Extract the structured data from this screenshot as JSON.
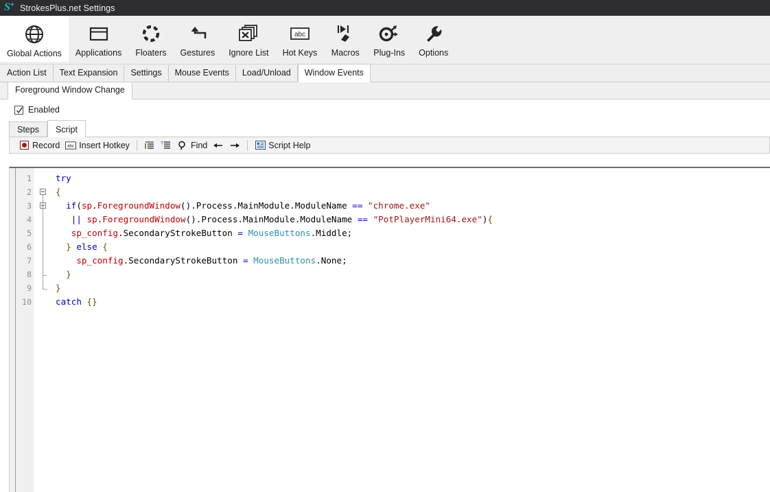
{
  "window": {
    "title": "StrokesPlus.net Settings",
    "icon": "strokesplus-logo-icon",
    "titlebar_bg": "#2d2d30",
    "titlebar_fg": "#f1f1f1"
  },
  "ribbon": {
    "items": [
      {
        "label": "Global Actions",
        "icon": "globe-icon",
        "selected": true
      },
      {
        "label": "Applications",
        "icon": "window-icon",
        "selected": false
      },
      {
        "label": "Floaters",
        "icon": "dashed-circle-icon",
        "selected": false
      },
      {
        "label": "Gestures",
        "icon": "gesture-arrow-icon",
        "selected": false
      },
      {
        "label": "Ignore List",
        "icon": "stacked-x-windows-icon",
        "selected": false
      },
      {
        "label": "Hot Keys",
        "icon": "abc-key-icon",
        "selected": false
      },
      {
        "label": "Macros",
        "icon": "macro-play-icon",
        "selected": false
      },
      {
        "label": "Plug-Ins",
        "icon": "plugin-node-icon",
        "selected": false
      },
      {
        "label": "Options",
        "icon": "wrench-icon",
        "selected": false
      }
    ]
  },
  "tabs": {
    "items": [
      {
        "label": "Action List",
        "active": false
      },
      {
        "label": "Text Expansion",
        "active": false
      },
      {
        "label": "Settings",
        "active": false
      },
      {
        "label": "Mouse Events",
        "active": false
      },
      {
        "label": "Load/Unload",
        "active": false
      },
      {
        "label": "Window Events",
        "active": true
      }
    ]
  },
  "subtabs": {
    "items": [
      {
        "label": "Foreground Window Change",
        "active": true
      }
    ]
  },
  "enabled": {
    "label": "Enabled",
    "checked": true
  },
  "script_tabs": {
    "items": [
      {
        "label": "Steps",
        "active": false
      },
      {
        "label": "Script",
        "active": true
      }
    ]
  },
  "script_toolbar": {
    "record_label": "Record",
    "record_icon": "record-circle-icon",
    "insert_hotkey_label": "Insert Hotkey",
    "insert_hotkey_icon": "abc-key-icon",
    "indent_icon": "indent-lines-icon",
    "uncomment_icon": "comment-lines-icon",
    "find_label": "Find",
    "find_icon": "magnifier-icon",
    "back_icon": "arrow-left-icon",
    "forward_icon": "arrow-right-icon",
    "script_help_label": "Script Help",
    "script_help_icon": "help-document-icon"
  },
  "editor": {
    "line_numbers": [
      "1",
      "2",
      "3",
      "4",
      "5",
      "6",
      "7",
      "8",
      "9",
      "10"
    ],
    "code_lines": [
      {
        "n": 1,
        "text": "try"
      },
      {
        "n": 2,
        "text": "{"
      },
      {
        "n": 3,
        "text": "    if(sp.ForegroundWindow().Process.MainModule.ModuleName == \"chrome.exe\""
      },
      {
        "n": 4,
        "text": "      || sp.ForegroundWindow().Process.MainModule.ModuleName == \"PotPlayerMini64.exe\"){"
      },
      {
        "n": 5,
        "text": "      sp_config.SecondaryStrokeButton = MouseButtons.Middle;"
      },
      {
        "n": 6,
        "text": "    } else {"
      },
      {
        "n": 7,
        "text": "      sp_config.SecondaryStrokeButton = MouseButtons.None;"
      },
      {
        "n": 8,
        "text": "    }"
      },
      {
        "n": 9,
        "text": "}"
      },
      {
        "n": 10,
        "text": "catch {}"
      }
    ],
    "colors": {
      "keyword": "#0000c0",
      "identifier": "#c00000",
      "type": "#2b91af",
      "string": "#a31515",
      "brace": "#7a4f00",
      "plain": "#000000",
      "gutter_bg": "#f0f0f0",
      "gutter_fg": "#8c8c8c"
    }
  }
}
